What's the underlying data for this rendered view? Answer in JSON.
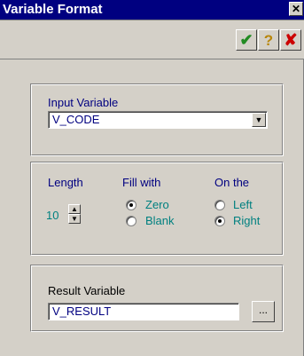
{
  "window": {
    "title": "Variable Format",
    "close_label": "✕"
  },
  "toolbar": {
    "ok_icon": "checkmark-icon",
    "help_icon": "question-icon",
    "cancel_icon": "x-icon",
    "ok_glyph": "✔",
    "help_glyph": "?",
    "cancel_glyph": "✘"
  },
  "input_panel": {
    "label": "Input Variable",
    "value": "V_CODE",
    "dropdown_glyph": "▼"
  },
  "format_panel": {
    "length_label": "Length",
    "length_value": "10",
    "fill_label": "Fill with",
    "fill_options": [
      {
        "label": "Zero",
        "selected": true
      },
      {
        "label": "Blank",
        "selected": false
      }
    ],
    "side_label": "On the",
    "side_options": [
      {
        "label": "Left",
        "selected": false
      },
      {
        "label": "Right",
        "selected": true
      }
    ],
    "spin_up": "▲",
    "spin_down": "▼"
  },
  "result_panel": {
    "label": "Result Variable",
    "value": "V_RESULT",
    "browse_label": "..."
  },
  "colors": {
    "title_bar": "#000080",
    "face": "#d4d0c8",
    "label_blue": "#000080",
    "label_teal": "#008080"
  }
}
